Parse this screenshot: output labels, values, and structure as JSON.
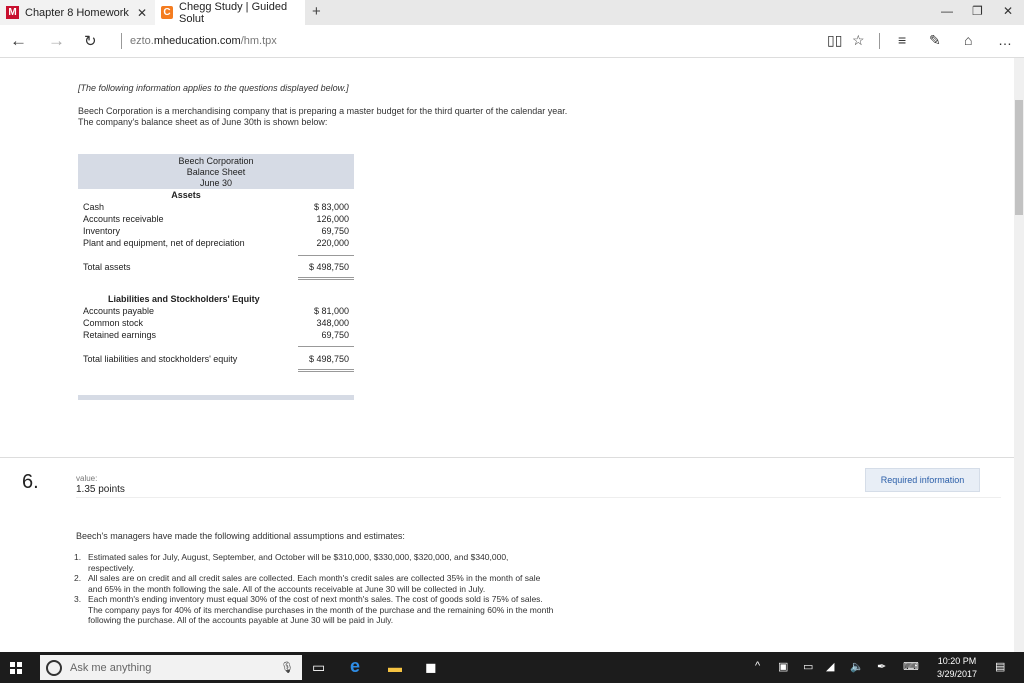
{
  "browser": {
    "tabs": [
      {
        "title": "Chapter 8 Homework",
        "favicon": "M",
        "active": false
      },
      {
        "title": "Chegg Study | Guided Solut",
        "favicon": "C",
        "active": true
      }
    ],
    "new_tab": "+",
    "url_prefix": "ezto.",
    "url_domain": "mheducation.com",
    "url_path": "/hm.tpx"
  },
  "content": {
    "intro": "[The following information applies to the questions displayed below.]",
    "paragraph": "Beech Corporation is a merchandising company that is preparing a master budget for the third quarter of the calendar year. The company's balance sheet as of June 30th is shown below:",
    "balance_sheet": {
      "company": "Beech Corporation",
      "title": "Balance Sheet",
      "date": "June 30",
      "assets_heading": "Assets",
      "assets": [
        {
          "label": "Cash",
          "value": "$ 83,000"
        },
        {
          "label": "Accounts receivable",
          "value": "126,000"
        },
        {
          "label": "Inventory",
          "value": "69,750"
        },
        {
          "label": "Plant and equipment, net of depreciation",
          "value": "220,000"
        }
      ],
      "total_assets": {
        "label": "Total assets",
        "value": "$ 498,750"
      },
      "liab_heading": "Liabilities and Stockholders' Equity",
      "liabilities": [
        {
          "label": "Accounts payable",
          "value": "$ 81,000"
        },
        {
          "label": "Common stock",
          "value": "348,000"
        },
        {
          "label": "Retained earnings",
          "value": "69,750"
        }
      ],
      "total_liab": {
        "label": "Total liabilities and stockholders' equity",
        "value": "$ 498,750"
      }
    },
    "question": {
      "number": "6.",
      "value_label": "value:",
      "points": "1.35 points",
      "required_button": "Required information",
      "assumptions_heading": "Beech's managers have made the following additional assumptions and estimates:",
      "items": [
        {
          "n": "1.",
          "text": "Estimated sales for July, August, September, and October will be $310,000, $330,000, $320,000, and $340,000, respectively."
        },
        {
          "n": "2.",
          "text": "All sales are on credit and all credit sales are collected. Each month's credit sales are collected 35% in the month of sale and 65% in the month following the sale. All of the accounts receivable at June 30 will be collected in July."
        },
        {
          "n": "3.",
          "text": "Each month's ending inventory must equal 30% of the cost of next month's sales. The cost of goods sold is 75% of sales. The company pays for 40% of its merchandise purchases in the month of the purchase and the remaining 60% in the month following the purchase. All of the accounts payable at June 30 will be paid in July."
        }
      ]
    }
  },
  "taskbar": {
    "search_placeholder": "Ask me anything",
    "time": "10:20 PM",
    "date": "3/29/2017"
  }
}
